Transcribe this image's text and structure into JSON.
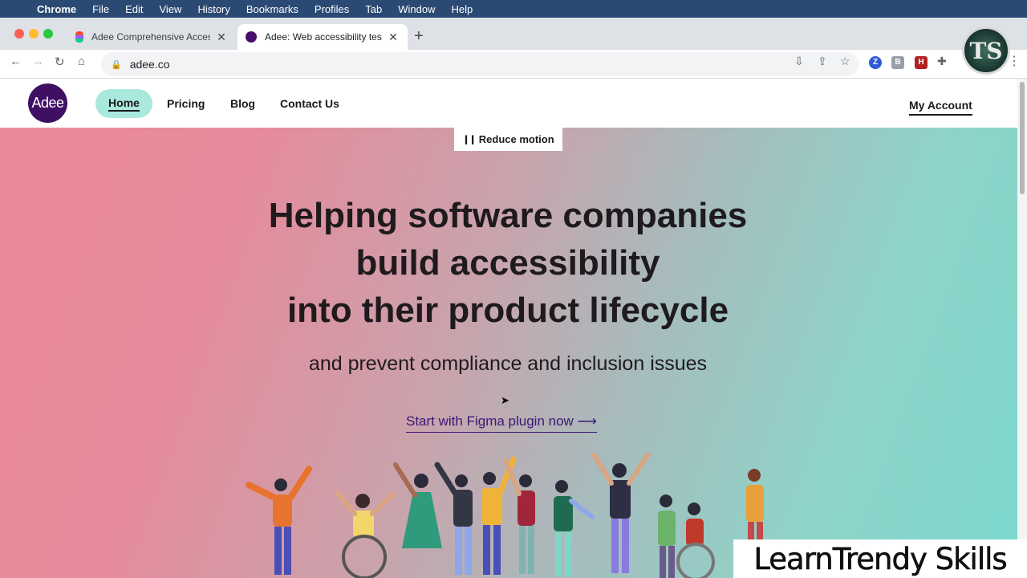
{
  "menubar": {
    "app": "Chrome",
    "items": [
      "File",
      "Edit",
      "View",
      "History",
      "Bookmarks",
      "Profiles",
      "Tab",
      "Window",
      "Help"
    ]
  },
  "tabs": [
    {
      "title": "Adee Comprehensive Accessil",
      "favicon": "figma-icon",
      "active": false
    },
    {
      "title": "Adee: Web accessibility testin",
      "favicon": "adee-icon",
      "active": true
    }
  ],
  "address_bar": {
    "url": "adee.co"
  },
  "profile_initials": "TS",
  "site": {
    "logo_text": "Adee",
    "nav": {
      "home": "Home",
      "pricing": "Pricing",
      "blog": "Blog",
      "contact": "Contact Us",
      "account": "My Account"
    },
    "reduce_motion": "Reduce motion",
    "headline": {
      "line1": "Helping software companies",
      "line2": "build accessibility",
      "line3": "into their product lifecycle"
    },
    "subheadline": "and prevent compliance and inclusion issues",
    "cta": "Start with Figma plugin now ⟶"
  },
  "watermark": "LearnTrendy Skills",
  "colors": {
    "menubar": "#2b4a73",
    "logo_bg": "#3f0f63",
    "nav_active_bg": "#a9e8dc",
    "hero_left": "#e98a9a",
    "hero_right": "#7bd8cd",
    "cta": "#3b1773"
  }
}
